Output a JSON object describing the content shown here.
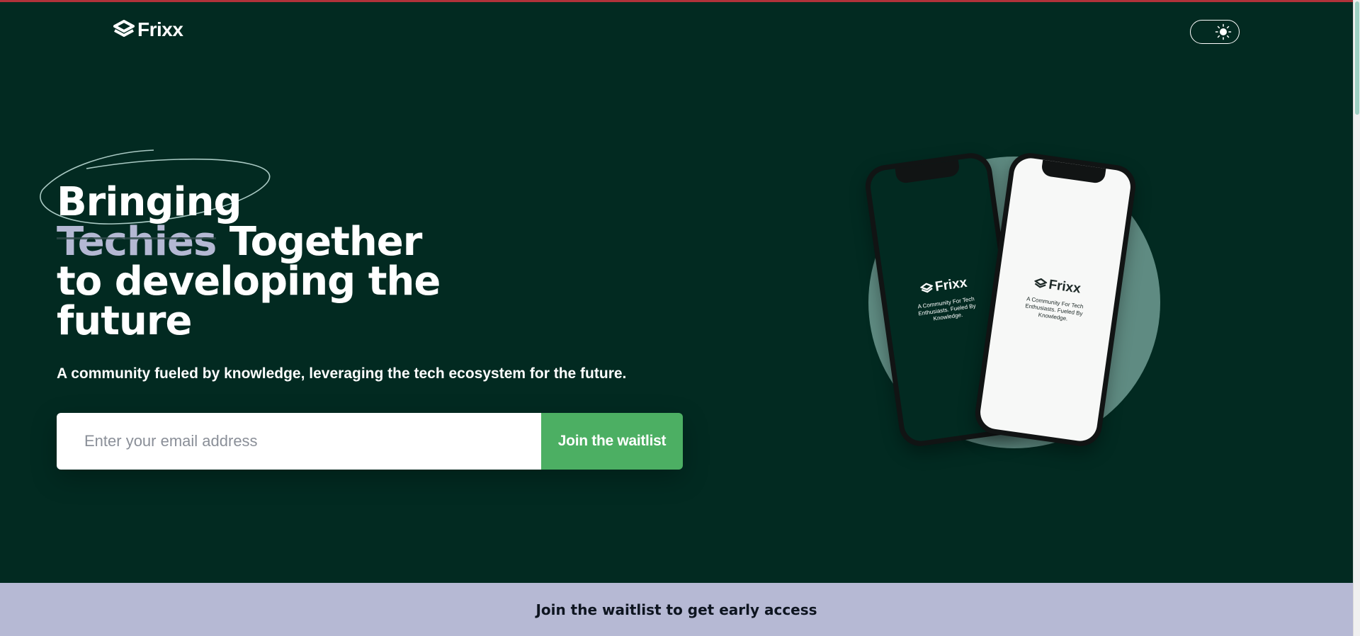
{
  "header": {
    "brand": "Frixx",
    "logo_icon": "frixx-logo-icon",
    "theme_toggle_icon": "sun-icon"
  },
  "hero": {
    "headline": {
      "word1": "Bringing",
      "word_highlight": "Techies",
      "word2": " Together",
      "line3": "to developing the",
      "line4": "future"
    },
    "subtitle": "A community fueled by knowledge, leveraging the tech ecosystem for the future.",
    "email_placeholder": "Enter your email address",
    "email_value": "",
    "cta_label": "Join the waitlist"
  },
  "phones": {
    "brand": "Frixx",
    "tagline_dark": "A Community For Tech Enthusiasts. Fueled By Knowledge.",
    "tagline_light": "A Community For Tech Enthusiasts. Fueled By Knowledge."
  },
  "banner": {
    "text": "Join the waitlist to get early access"
  },
  "colors": {
    "background": "#022a21",
    "accent_green": "#4caf63",
    "highlight_lavender": "#b6b9d4",
    "top_accent_red": "#b0323a",
    "circle_sage": "#5f8b82"
  }
}
